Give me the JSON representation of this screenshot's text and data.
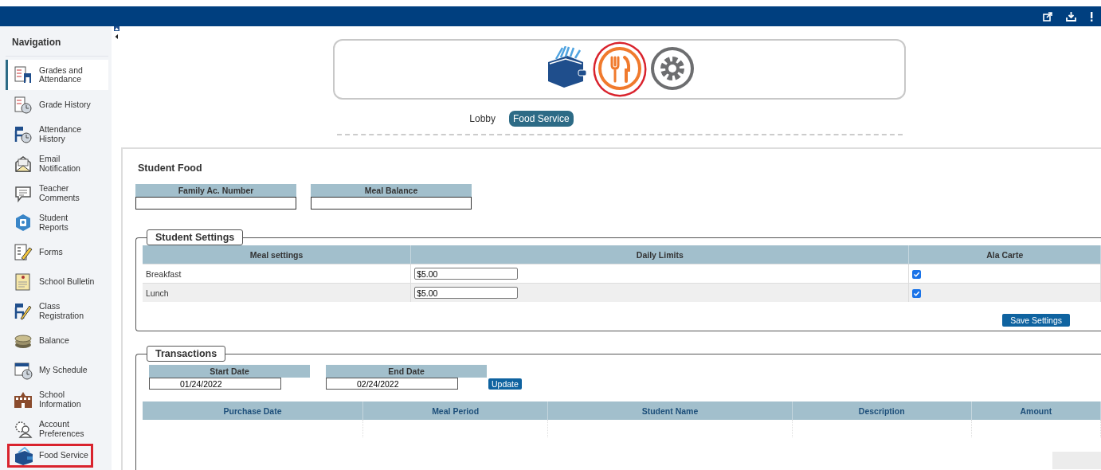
{
  "sidebar": {
    "title": "Navigation",
    "items": [
      {
        "label": "Grades and\nAttendance",
        "selected": true,
        "highlighted": false
      },
      {
        "label": "Grade History",
        "selected": false,
        "highlighted": false
      },
      {
        "label": "Attendance\nHistory",
        "selected": false,
        "highlighted": false
      },
      {
        "label": "Email\nNotification",
        "selected": false,
        "highlighted": false
      },
      {
        "label": "Teacher\nComments",
        "selected": false,
        "highlighted": false
      },
      {
        "label": "Student\nReports",
        "selected": false,
        "highlighted": false
      },
      {
        "label": "Forms",
        "selected": false,
        "highlighted": false
      },
      {
        "label": "School Bulletin",
        "selected": false,
        "highlighted": false
      },
      {
        "label": "Class\nRegistration",
        "selected": false,
        "highlighted": false
      },
      {
        "label": "Balance",
        "selected": false,
        "highlighted": false
      },
      {
        "label": "My Schedule",
        "selected": false,
        "highlighted": false
      },
      {
        "label": "School\nInformation",
        "selected": false,
        "highlighted": false
      },
      {
        "label": "Account\nPreferences",
        "selected": false,
        "highlighted": false
      },
      {
        "label": "Food Service",
        "selected": false,
        "highlighted": true
      }
    ]
  },
  "apps": [
    {
      "kind": "wallet",
      "highlighted": false
    },
    {
      "kind": "dining",
      "highlighted": true
    },
    {
      "kind": "settings",
      "highlighted": false
    }
  ],
  "tabs": [
    {
      "label": "Lobby",
      "selected": false
    },
    {
      "label": "Food Service",
      "selected": true
    }
  ],
  "student_food": {
    "title": "Student Food",
    "fields": [
      {
        "label": "Family Ac. Number"
      },
      {
        "label": "Meal Balance"
      }
    ]
  },
  "student_settings": {
    "legend": "Student Settings",
    "columns": [
      "Meal settings",
      "Daily Limits",
      "Ala Carte"
    ],
    "rows": [
      {
        "meal": "Breakfast",
        "daily_limit": "$5.00",
        "ala_carte": true
      },
      {
        "meal": "Lunch",
        "daily_limit": "$5.00",
        "ala_carte": true
      }
    ],
    "save_button": "Save Settings"
  },
  "transactions": {
    "legend": "Transactions",
    "start_date": {
      "label": "Start Date",
      "value": "01/24/2022"
    },
    "end_date": {
      "label": "End Date",
      "value": "02/24/2022"
    },
    "update_button": "Update",
    "columns": [
      "Purchase Date",
      "Meal Period",
      "Student Name",
      "Description",
      "Amount"
    ]
  }
}
